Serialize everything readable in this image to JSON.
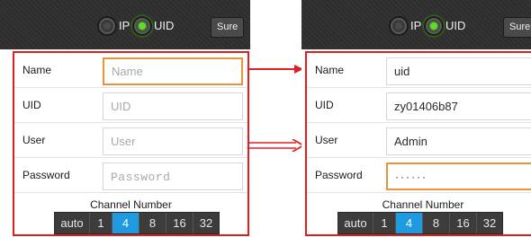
{
  "left_screen": {
    "mode_options": [
      {
        "label": "IP",
        "selected": false
      },
      {
        "label": "UID",
        "selected": true
      }
    ],
    "confirm_label": "Sure",
    "fields": [
      {
        "label": "Name",
        "value": "",
        "placeholder": "Name",
        "focused": true
      },
      {
        "label": "UID",
        "value": "",
        "placeholder": "UID"
      },
      {
        "label": "User",
        "value": "",
        "placeholder": "User"
      },
      {
        "label": "Password",
        "value": "",
        "placeholder": "Password"
      }
    ],
    "channel_title": "Channel Number",
    "channel_options": [
      "auto",
      "1",
      "4",
      "8",
      "16",
      "32"
    ],
    "channel_selected": "4"
  },
  "right_screen": {
    "mode_options": [
      {
        "label": "IP",
        "selected": false
      },
      {
        "label": "UID",
        "selected": true
      }
    ],
    "confirm_label": "Sure",
    "fields": [
      {
        "label": "Name",
        "value": "uid"
      },
      {
        "label": "UID",
        "value": "zy01406b87"
      },
      {
        "label": "User",
        "value": "Admin"
      },
      {
        "label": "Password",
        "value": "······",
        "focused": true
      }
    ],
    "channel_title": "Channel Number",
    "channel_options": [
      "auto",
      "1",
      "4",
      "8",
      "16",
      "32"
    ],
    "channel_selected": "4"
  },
  "colors": {
    "highlight_border": "#e02020",
    "focus_border": "#e8953a",
    "selected_channel": "#1e9ae0",
    "radio_selected": "#5ddc2a",
    "topbar": "#2f2f2f"
  },
  "icons": [
    "arrow-right-icon",
    "double-arrow-right-icon"
  ]
}
